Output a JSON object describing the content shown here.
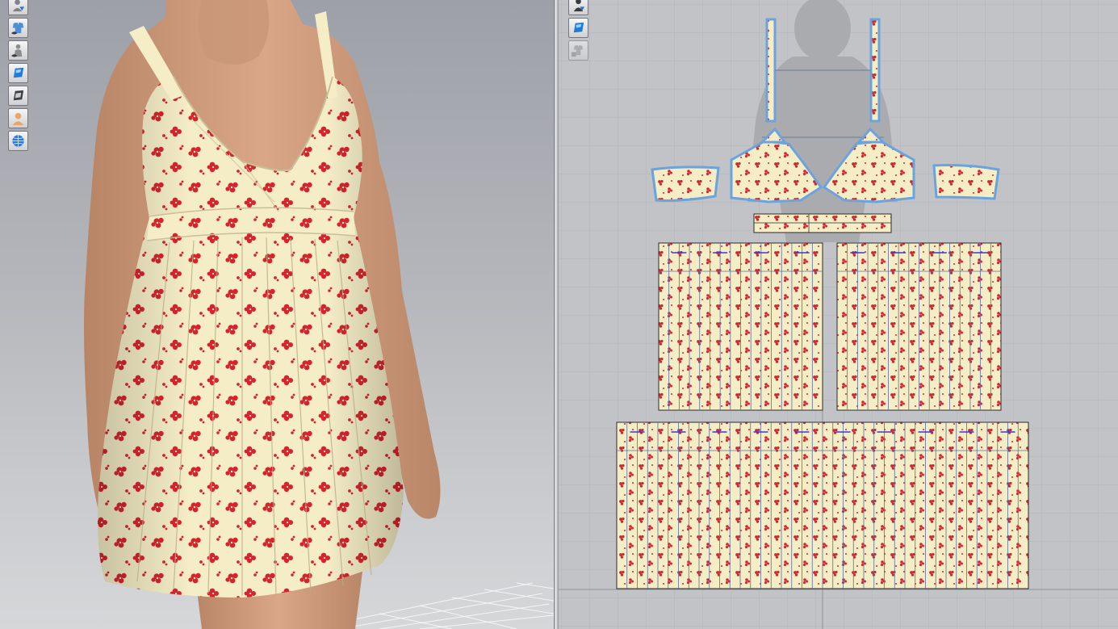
{
  "app": {
    "layout": "split-view",
    "left_view": "3d-garment-view",
    "right_view": "2d-pattern-view"
  },
  "colors": {
    "fabric": "#f4edc6",
    "print": "#d8232e",
    "seam_outline": "#6aa3dd",
    "avatar_silhouette": "#a9abaf",
    "grid_line": "#b3b5b8",
    "pleat_marker": "#3a3ad8"
  },
  "toolbar3d": {
    "buttons": [
      {
        "name": "avatar-display-icon",
        "enabled": true
      },
      {
        "name": "garment-visibility-icon",
        "enabled": true
      },
      {
        "name": "avatar-visibility-icon",
        "enabled": true
      },
      {
        "name": "fabric-texture-icon",
        "enabled": true
      },
      {
        "name": "texture-surface-icon",
        "enabled": true
      },
      {
        "name": "avatar-skin-icon",
        "enabled": true
      },
      {
        "name": "environment-globe-icon",
        "enabled": true
      }
    ]
  },
  "toolbar2d": {
    "buttons": [
      {
        "name": "avatar-silhouette-icon",
        "enabled": true
      },
      {
        "name": "pattern-texture-icon",
        "enabled": true
      },
      {
        "name": "locked-garment-icon",
        "enabled": false
      }
    ]
  },
  "patterns": [
    {
      "name": "shoulder-strap-left",
      "shape": "strap"
    },
    {
      "name": "shoulder-strap-right",
      "shape": "strap"
    },
    {
      "name": "bodice-side-left",
      "shape": "bodice"
    },
    {
      "name": "bodice-front-left",
      "shape": "bodice"
    },
    {
      "name": "bodice-front-right",
      "shape": "bodice"
    },
    {
      "name": "bodice-side-right",
      "shape": "bodice"
    },
    {
      "name": "waistband",
      "shape": "band"
    },
    {
      "name": "skirt-front-left",
      "shape": "pleated-panel"
    },
    {
      "name": "skirt-front-right",
      "shape": "pleated-panel"
    },
    {
      "name": "skirt-back",
      "shape": "pleated-panel"
    }
  ]
}
